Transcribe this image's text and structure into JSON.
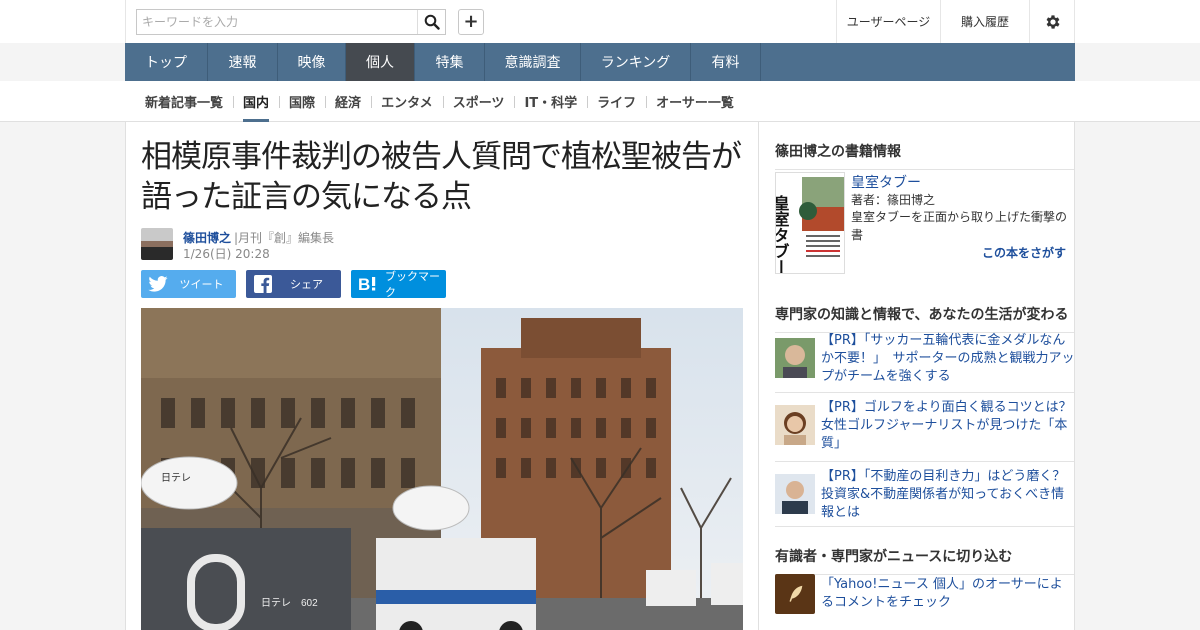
{
  "header": {
    "search_placeholder": "キーワードを入力",
    "add_label": "+",
    "user_page_label": "ユーザーページ",
    "history_label": "購入履歴"
  },
  "nav": {
    "items": [
      {
        "label": "トップ",
        "active": false
      },
      {
        "label": "速報",
        "active": false
      },
      {
        "label": "映像",
        "active": false
      },
      {
        "label": "個人",
        "active": true
      },
      {
        "label": "特集",
        "active": false
      },
      {
        "label": "意識調査",
        "active": false
      },
      {
        "label": "ランキング",
        "active": false
      },
      {
        "label": "有料",
        "active": false
      }
    ]
  },
  "subnav": {
    "items": [
      {
        "label": "新着記事一覧",
        "active": false
      },
      {
        "label": "国内",
        "active": true
      },
      {
        "label": "国際",
        "active": false
      },
      {
        "label": "経済",
        "active": false
      },
      {
        "label": "エンタメ",
        "active": false
      },
      {
        "label": "スポーツ",
        "active": false
      },
      {
        "label": "IT・科学",
        "active": false
      },
      {
        "label": "ライフ",
        "active": false
      },
      {
        "label": "オーサー一覧",
        "active": false
      }
    ]
  },
  "article": {
    "title": "相模原事件裁判の被告人質問で植松聖被告が語った証言の気になる点",
    "author_name": "篠田博之",
    "author_role": "|月刊『創』編集長",
    "date": "1/26(日) 20:28",
    "share": {
      "tweet": "ツイート",
      "facebook": "シェア",
      "hatena": "ブックマーク"
    },
    "image_signs": {
      "van_logo_left": "日テレ",
      "truck_label": "日テレ",
      "truck_number": "602"
    }
  },
  "sidebar": {
    "book_section_title": "篠田博之の書籍情報",
    "book": {
      "title": "皇室タブー",
      "author": "著者：篠田博之",
      "description": "皇室タブーを正面から取り上げた衝撃の書",
      "link": "この本をさがす",
      "cover_title": "皇室タブー"
    },
    "pr_section_title": "専門家の知識と情報で、あなたの生活が変わる",
    "pr_items": [
      {
        "text": "【PR】「サッカー五輪代表に金メダルなんか不要！」　サポーターの成熟と観戦力アップがチームを強くする"
      },
      {
        "text": "【PR】ゴルフをより面白く観るコツとは？　女性ゴルフジャーナリストが見つけた「本質」"
      },
      {
        "text": "【PR】「不動産の目利き力」はどう磨く？　投資家&不動産関係者が知っておくべき情報とは"
      }
    ],
    "comment_section_title": "有識者・専門家がニュースに切り込む",
    "comment_text": "「Yahoo!ニュース 個人」のオーサーによるコメントをチェック"
  },
  "colors": {
    "nav_bg": "#4d6f8e",
    "nav_active": "#454a50",
    "link": "#1e4f9c",
    "twitter": "#55acee",
    "facebook": "#3b5998",
    "hatena": "#008fde"
  }
}
